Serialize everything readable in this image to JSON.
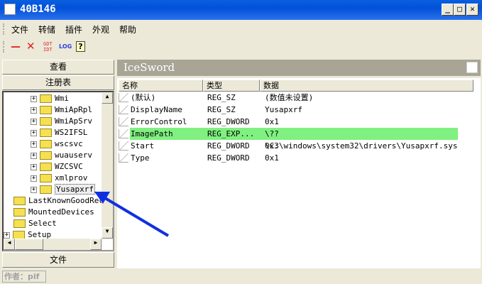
{
  "window": {
    "title": "40B146",
    "min": "_",
    "max": "□",
    "close": "✕"
  },
  "menu": [
    "文件",
    "转储",
    "插件",
    "外观",
    "帮助"
  ],
  "toolbar": {
    "minus": "—",
    "close": "✕",
    "gdt_top": "GDT",
    "gdt_bottom": "IDT",
    "log": "LOG",
    "help": "?"
  },
  "left": {
    "view_button": "查看",
    "registry_button": "注册表",
    "file_button": "文件",
    "tree": [
      {
        "label": "Wmi",
        "level": 2
      },
      {
        "label": "WmiApRpl",
        "level": 2
      },
      {
        "label": "WmiApSrv",
        "level": 2
      },
      {
        "label": "WS2IFSL",
        "level": 2
      },
      {
        "label": "wscsvc",
        "level": 2
      },
      {
        "label": "wuauserv",
        "level": 2
      },
      {
        "label": "WZCSVC",
        "level": 2
      },
      {
        "label": "xmlprov",
        "level": 2
      },
      {
        "label": "Yusapxrf",
        "level": 2,
        "selected": true
      },
      {
        "label": "LastKnownGoodRec",
        "level": 1
      },
      {
        "label": "MountedDevices",
        "level": 1
      },
      {
        "label": "Select",
        "level": 1
      },
      {
        "label": "Setup",
        "level": 1
      }
    ]
  },
  "right": {
    "header": "IceSword",
    "columns": [
      "名称",
      "类型",
      "数据"
    ],
    "rows": [
      {
        "name": "(默认)",
        "type": "REG_SZ",
        "data": "(数值未设置)"
      },
      {
        "name": "DisplayName",
        "type": "REG_SZ",
        "data": "Yusapxrf"
      },
      {
        "name": "ErrorControl",
        "type": "REG_DWORD",
        "data": "0x1"
      },
      {
        "name": "ImagePath",
        "type": "REG_EXP...",
        "data": "\\??\\C:\\windows\\system32\\drivers\\Yusapxrf.sys",
        "highlighted": true
      },
      {
        "name": "Start",
        "type": "REG_DWORD",
        "data": "0x3"
      },
      {
        "name": "Type",
        "type": "REG_DWORD",
        "data": "0x1"
      }
    ]
  },
  "status": {
    "author": "作者：pif"
  },
  "colors": {
    "highlight": "#80f080",
    "arrow": "#1030e0",
    "titlebar": "#0a5fe0",
    "panel_header": "#a8a496"
  }
}
